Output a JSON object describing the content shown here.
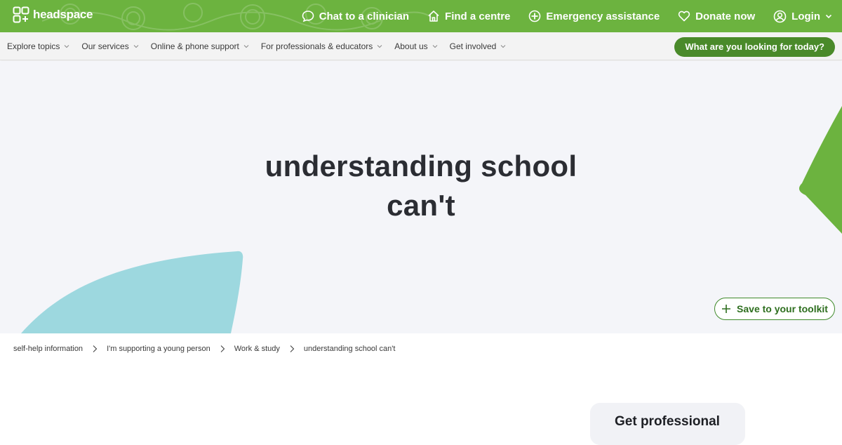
{
  "brand": {
    "name": "headspace"
  },
  "top_actions": [
    {
      "label": "Chat to a clinician",
      "icon": "chat-bubble-icon"
    },
    {
      "label": "Find a centre",
      "icon": "home-icon"
    },
    {
      "label": "Emergency assistance",
      "icon": "plus-circle-icon"
    },
    {
      "label": "Donate now",
      "icon": "heart-icon"
    },
    {
      "label": "Login",
      "icon": "user-circle-icon"
    }
  ],
  "nav": {
    "items": [
      {
        "label": "Explore topics"
      },
      {
        "label": "Our services"
      },
      {
        "label": "Online & phone support"
      },
      {
        "label": "For professionals & educators"
      },
      {
        "label": "About us"
      },
      {
        "label": "Get involved"
      }
    ],
    "search_label": "What are you looking for today?"
  },
  "hero": {
    "title_line1": "understanding school",
    "title_line2": "can't",
    "toolkit_label": "Save to your toolkit"
  },
  "breadcrumb": [
    {
      "label": "self-help information"
    },
    {
      "label": "I'm supporting a young person"
    },
    {
      "label": "Work & study"
    },
    {
      "label": "understanding school can't"
    }
  ],
  "side_card": {
    "title": "Get professional"
  },
  "colors": {
    "brand_green": "#6cb33f",
    "dark_green": "#4a8a2a",
    "hero_bg": "#f4f5f9",
    "accent_blue": "#9dd8df"
  }
}
